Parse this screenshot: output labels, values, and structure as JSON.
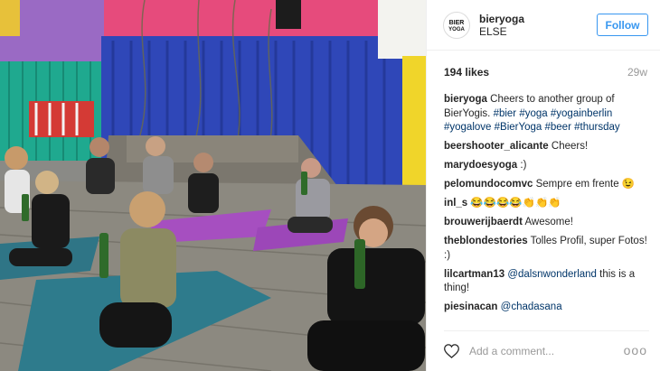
{
  "post": {
    "username": "bieryoga",
    "location": "ELSE",
    "follow_label": "Follow",
    "likes": "194 likes",
    "time_ago": "29w",
    "avatar_text": "BIER YOGA"
  },
  "comments": [
    {
      "user": "bieryoga",
      "parts": [
        {
          "t": "Cheers to another group of BierYogis. ",
          "tag": false
        },
        {
          "t": "#bier",
          "tag": true
        },
        {
          "t": " ",
          "tag": false
        },
        {
          "t": "#yoga",
          "tag": true
        },
        {
          "t": " ",
          "tag": false
        },
        {
          "t": "#yogainberlin",
          "tag": true
        },
        {
          "t": " ",
          "tag": false
        },
        {
          "t": "#yogalove",
          "tag": true
        },
        {
          "t": " ",
          "tag": false
        },
        {
          "t": "#BierYoga",
          "tag": true
        },
        {
          "t": " ",
          "tag": false
        },
        {
          "t": "#beer",
          "tag": true
        },
        {
          "t": " ",
          "tag": false
        },
        {
          "t": "#thursday",
          "tag": true
        }
      ]
    },
    {
      "user": "beershooter_alicante",
      "parts": [
        {
          "t": "Cheers!",
          "tag": false
        }
      ]
    },
    {
      "user": "marydoesyoga",
      "parts": [
        {
          "t": ":)",
          "tag": false
        }
      ]
    },
    {
      "user": "pelomundocomvc",
      "parts": [
        {
          "t": "Sempre em frente 😉",
          "tag": false
        }
      ]
    },
    {
      "user": "inl_s",
      "parts": [
        {
          "t": "😂😂😂😂👏👏👏",
          "tag": false
        }
      ]
    },
    {
      "user": "brouwerijbaerdt",
      "parts": [
        {
          "t": "Awesome!",
          "tag": false
        }
      ]
    },
    {
      "user": "theblondestories",
      "parts": [
        {
          "t": "Tolles Profil, super Fotos! :)",
          "tag": false
        }
      ]
    },
    {
      "user": "lilcartman13",
      "parts": [
        {
          "t": "@dalsnwonderland",
          "tag": true
        },
        {
          "t": " this is a thing!",
          "tag": false
        }
      ]
    },
    {
      "user": "piesinacan",
      "parts": [
        {
          "t": "@chadasana",
          "tag": true
        }
      ]
    }
  ],
  "add_comment": {
    "placeholder": "Add a comment..."
  },
  "more_label": "ooo",
  "icons": {
    "like": "heart-outline-icon",
    "more": "more-options-icon"
  },
  "colors": {
    "link": "#003569",
    "follow": "#3897f0",
    "muted": "#999999"
  }
}
